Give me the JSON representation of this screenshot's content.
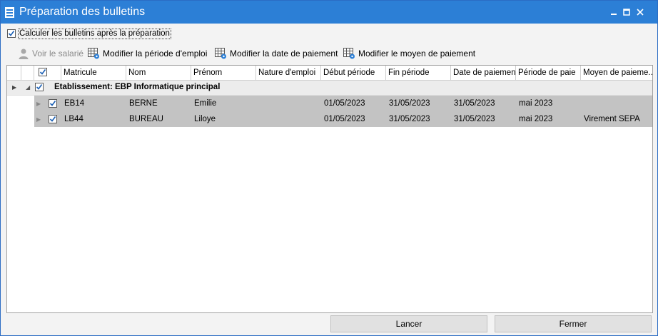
{
  "window": {
    "title": "Préparation des bulletins"
  },
  "options": {
    "calc_label": "Calculer les bulletins après la préparation",
    "calc_checked": true
  },
  "toolbar": {
    "voir": "Voir le salarié",
    "periode": "Modifier la période d'emploi",
    "date": "Modifier la date de paiement",
    "moyen": "Modifier le moyen de paiement"
  },
  "columns": [
    "Matricule",
    "Nom",
    "Prénom",
    "Nature d'emploi",
    "Début période",
    "Fin période",
    "Date de paiement",
    "Période de paie",
    "Moyen de paieme..."
  ],
  "group": {
    "label": "Etablissement: EBP Informatique principal"
  },
  "rows": [
    {
      "matricule": "EB14",
      "nom": "BERNE",
      "prenom": "Emilie",
      "nature": "",
      "debut": "01/05/2023",
      "fin": "31/05/2023",
      "date_paiement": "31/05/2023",
      "periode_paie": "mai 2023",
      "moyen": ""
    },
    {
      "matricule": "LB44",
      "nom": "BUREAU",
      "prenom": "Liloye",
      "nature": "",
      "debut": "01/05/2023",
      "fin": "31/05/2023",
      "date_paiement": "31/05/2023",
      "periode_paie": "mai 2023",
      "moyen": "Virement SEPA"
    }
  ],
  "buttons": {
    "lancer": "Lancer",
    "fermer": "Fermer"
  },
  "colors": {
    "titlebar": "#2c7fd6",
    "row_selected": "#c3c3c3",
    "check": "#1a5fb4"
  }
}
